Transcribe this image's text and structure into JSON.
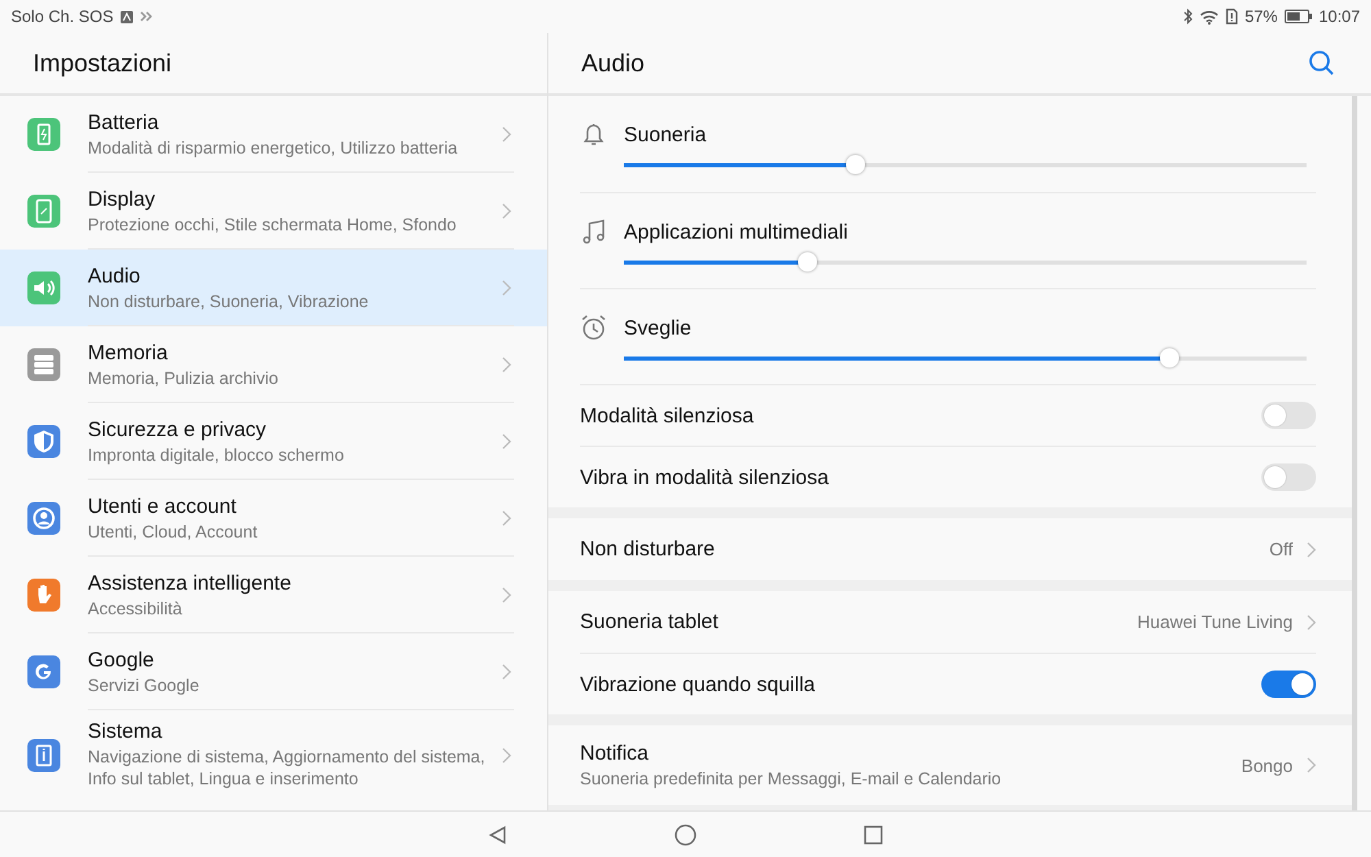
{
  "status_bar": {
    "carrier": "Solo Ch. SOS",
    "battery": "57%",
    "time": "10:07"
  },
  "sidebar": {
    "title": "Impostazioni",
    "items": [
      {
        "title": "Batteria",
        "subtitle": "Modalità di risparmio energetico, Utilizzo batteria",
        "color": "#4cc47a",
        "selected": false
      },
      {
        "title": "Display",
        "subtitle": "Protezione occhi, Stile schermata Home, Sfondo",
        "color": "#4cc47a",
        "selected": false
      },
      {
        "title": "Audio",
        "subtitle": "Non disturbare, Suoneria, Vibrazione",
        "color": "#4cc47a",
        "selected": true
      },
      {
        "title": "Memoria",
        "subtitle": "Memoria, Pulizia archivio",
        "color": "#9a9a9a",
        "selected": false
      },
      {
        "title": "Sicurezza e privacy",
        "subtitle": "Impronta digitale, blocco schermo",
        "color": "#4a86e0",
        "selected": false
      },
      {
        "title": "Utenti e account",
        "subtitle": "Utenti, Cloud, Account",
        "color": "#4a86e0",
        "selected": false
      },
      {
        "title": "Assistenza intelligente",
        "subtitle": "Accessibilità",
        "color": "#f07a2c",
        "selected": false
      },
      {
        "title": "Google",
        "subtitle": "Servizi Google",
        "color": "#4a86e0",
        "selected": false
      },
      {
        "title": "Sistema",
        "subtitle": "Navigazione di sistema, Aggiornamento del sistema, Info sul tablet, Lingua e inserimento",
        "color": "#4a86e0",
        "selected": false
      }
    ]
  },
  "detail": {
    "title": "Audio",
    "groups": [
      {
        "rows": [
          {
            "kind": "slider",
            "label": "Suoneria",
            "level": 0.34
          },
          {
            "kind": "slider",
            "label": "Applicazioni multimediali",
            "level": 0.27
          },
          {
            "kind": "slider",
            "label": "Sveglie",
            "level": 0.8
          },
          {
            "kind": "toggle",
            "label": "Modalità silenziosa",
            "on": false
          },
          {
            "kind": "toggle",
            "label": "Vibra in modalità silenziosa",
            "on": false
          }
        ]
      },
      {
        "rows": [
          {
            "kind": "link",
            "label": "Non disturbare",
            "value": "Off"
          }
        ]
      },
      {
        "rows": [
          {
            "kind": "link",
            "label": "Suoneria tablet",
            "value": "Huawei Tune Living"
          },
          {
            "kind": "toggle",
            "label": "Vibrazione quando squilla",
            "on": true
          }
        ]
      },
      {
        "rows": [
          {
            "kind": "link",
            "label": "Notifica",
            "subtitle": "Suoneria predefinita per Messaggi, E-mail e Calendario",
            "value": "Bongo"
          }
        ]
      }
    ]
  }
}
